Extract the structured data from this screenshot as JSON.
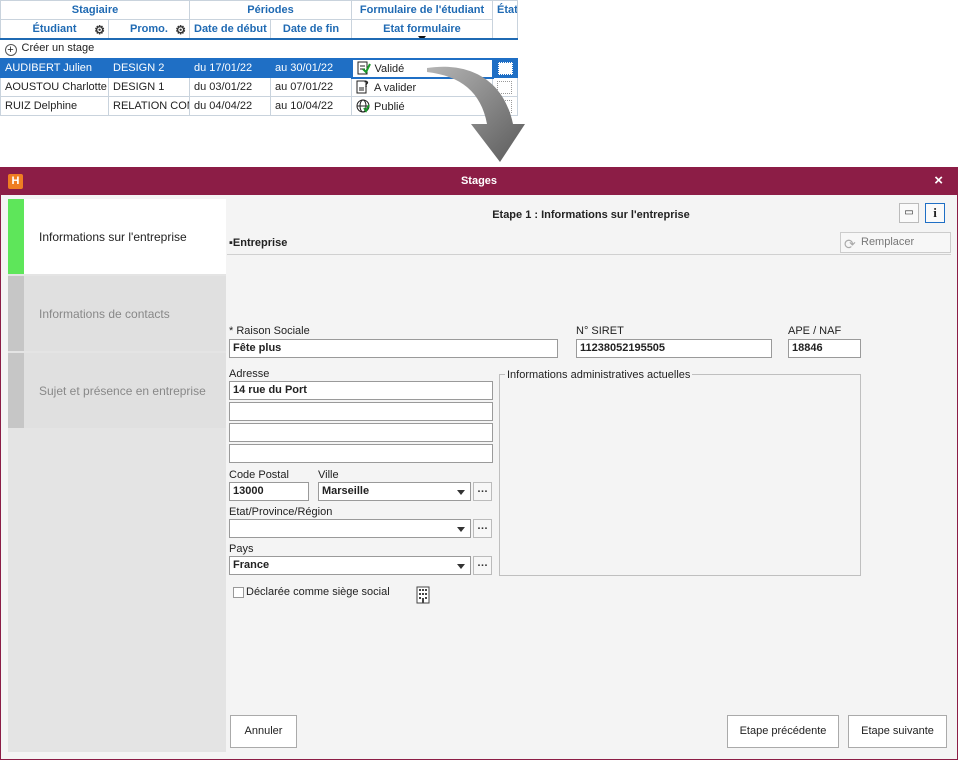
{
  "table": {
    "group_headers": [
      "Stagiaire",
      "Périodes",
      "Formulaire de l'étudiant",
      "État st."
    ],
    "headers": [
      "Étudiant",
      "Promo.",
      "Date de début",
      "Date de fin",
      "Etat formulaire"
    ],
    "create_label": "Créer un stage",
    "rows": [
      {
        "student": "AUDIBERT Julien",
        "promo": "DESIGN 2",
        "start": "du 17/01/22",
        "end": "au 30/01/22",
        "status": "Validé",
        "status_icon": "form-validated-icon"
      },
      {
        "student": "AOUSTOU Charlotte",
        "promo": "DESIGN 1",
        "start": "du 03/01/22",
        "end": "au 07/01/22",
        "status": "A valider",
        "status_icon": "form-pending-icon"
      },
      {
        "student": "RUIZ Delphine",
        "promo": "RELATION COM",
        "start": "du 04/04/22",
        "end": "au 10/04/22",
        "status": "Publié",
        "status_icon": "globe-published-icon"
      }
    ]
  },
  "dialog": {
    "title": "Stages",
    "steps": [
      "Informations sur l'entreprise",
      "Informations de contacts",
      "Sujet et présence en entreprise"
    ],
    "step_title": "Etape 1 : Informations sur l'entreprise",
    "section_title": "Entreprise",
    "replace_label": "Remplacer",
    "form": {
      "raison_sociale_label": "* Raison Sociale",
      "raison_sociale": "Fête plus",
      "siret_label": "N° SIRET",
      "siret": "11238052195505",
      "ape_label": "APE / NAF",
      "ape": "18846",
      "adresse_label": "Adresse",
      "adresse1": "14 rue du Port",
      "adresse2": "",
      "adresse3": "",
      "adresse4": "",
      "cp_label": "Code Postal",
      "cp": "13000",
      "ville_label": "Ville",
      "ville": "Marseille",
      "region_label": "Etat/Province/Région",
      "region": "",
      "pays_label": "Pays",
      "pays": "France",
      "admin_info_label": "Informations administratives actuelles",
      "siege_label": "Déclarée comme siège social"
    },
    "buttons": {
      "cancel": "Annuler",
      "prev": "Etape précédente",
      "next": "Etape suivante"
    },
    "colors": {
      "titlebar": "#8c1d46",
      "active_step": "#5ee65a",
      "selection": "#1f6fc5"
    }
  }
}
